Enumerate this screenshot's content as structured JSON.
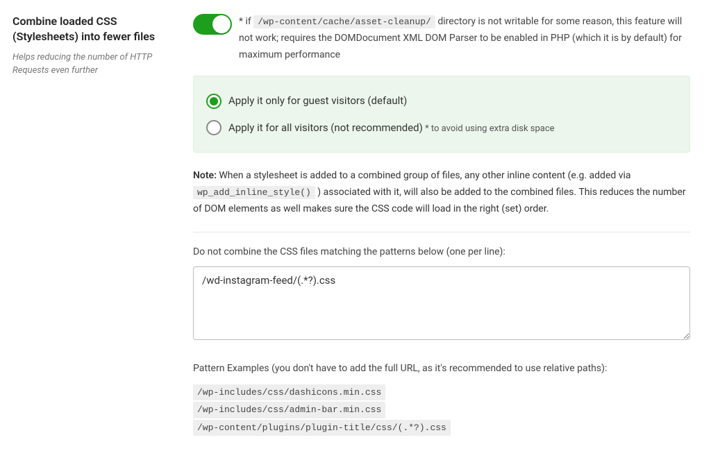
{
  "setting": {
    "title": "Combine loaded CSS (Stylesheets) into fewer files",
    "subtitle": "Helps reducing the number of HTTP Requests even further"
  },
  "toggle_desc": {
    "prefix": "* if ",
    "code": "/wp-content/cache/asset-cleanup/",
    "suffix": " directory is not writable for some reason, this feature will not work; requires the DOMDocument XML DOM Parser to be enabled in PHP (which it is by default) for maximum performance"
  },
  "options": {
    "guest": "Apply it only for guest visitors (default)",
    "all": "Apply it for all visitors (not recommended)",
    "all_hint": " * to avoid using extra disk space"
  },
  "note": {
    "label": "Note:",
    "part1": " When a stylesheet is added to a combined group of files, any other inline content (e.g. added via ",
    "code": "wp_add_inline_style()",
    "part2": " ) associated with it, will also be added to the combined files. This reduces the number of DOM elements as well makes sure the CSS code will load in the right (set) order."
  },
  "patterns": {
    "label": "Do not combine the CSS files matching the patterns below (one per line):",
    "value": "/wd-instagram-feed/(.*?).css"
  },
  "examples": {
    "label": "Pattern Examples (you don't have to add the full URL, as it's recommended to use relative paths):",
    "line1": "/wp-includes/css/dashicons.min.css",
    "line2": "/wp-includes/css/admin-bar.min.css",
    "line3": "/wp-content/plugins/plugin-title/css/(.*?).css"
  }
}
